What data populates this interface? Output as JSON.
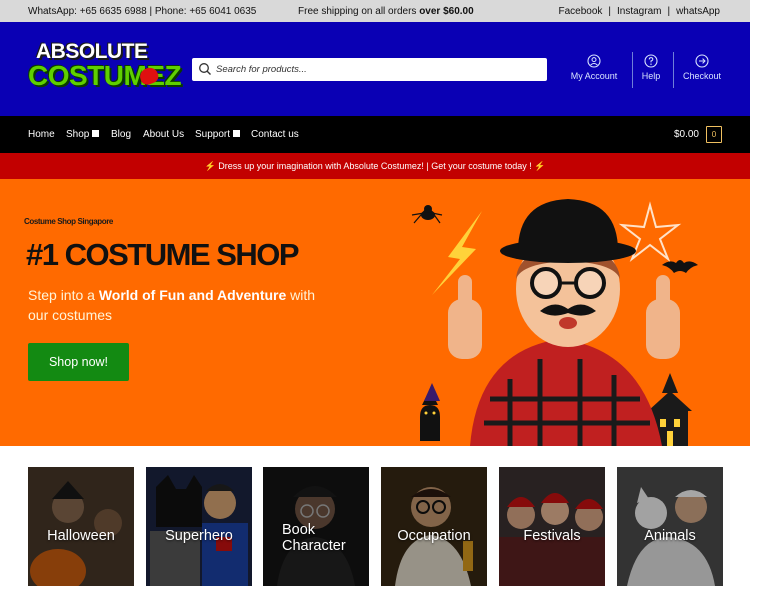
{
  "topbar": {
    "contact": "WhatsApp: +65 6635 6988 | Phone: +65 6041 0635",
    "shipping_prefix": "Free shipping on all orders ",
    "shipping_bold": "over $60.00",
    "links": [
      "Facebook",
      "Instagram",
      "whatsApp"
    ]
  },
  "header": {
    "logo_line1": "ABSOLUTE",
    "logo_line2": "COSTUMEZ",
    "search_placeholder": "Search for products...",
    "links": [
      {
        "label": "My Account",
        "icon": "user-icon"
      },
      {
        "label": "Help",
        "icon": "help-icon"
      },
      {
        "label": "Checkout",
        "icon": "arrow-right-icon"
      }
    ]
  },
  "nav": {
    "items": [
      {
        "label": "Home",
        "dropdown": false
      },
      {
        "label": "Shop",
        "dropdown": true
      },
      {
        "label": "Blog",
        "dropdown": false
      },
      {
        "label": "About Us",
        "dropdown": false
      },
      {
        "label": "Support",
        "dropdown": true
      },
      {
        "label": "Contact us",
        "dropdown": false
      }
    ],
    "cart_total": "$0.00",
    "cart_count": "0"
  },
  "promo": {
    "text": "⚡ Dress up your imagination with Absolute Costumez! | Get your costume today ! ⚡"
  },
  "hero": {
    "eyebrow": "Costume Shop Singapore",
    "headline": "#1 COSTUME SHOP",
    "sub_1": "Step into a ",
    "sub_bold": "World of Fun and Adventure",
    "sub_2": " with our costumes",
    "cta": "Shop now!"
  },
  "categories": [
    {
      "label": "Halloween"
    },
    {
      "label": "Superhero"
    },
    {
      "label": "Book Character"
    },
    {
      "label": "Occupation"
    },
    {
      "label": "Festivals"
    },
    {
      "label": "Animals"
    }
  ],
  "colors": {
    "topbar": "#d9d9d9",
    "header": "#0a00b4",
    "nav": "#000000",
    "promo": "#c20000",
    "hero": "#ff6a00",
    "cta": "#138a12"
  }
}
